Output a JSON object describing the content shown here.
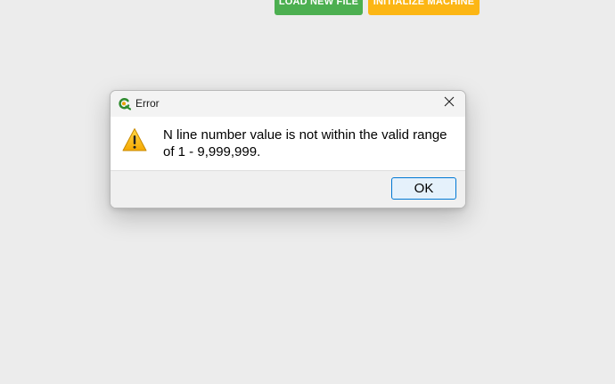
{
  "top_buttons": {
    "load_label": "LOAD NEW FILE",
    "init_label": "INITIALIZE MACHINE",
    "load_color": "#4caf50",
    "init_color": "#fcb614"
  },
  "dialog": {
    "title": "Error",
    "app_icon": "app-logo-icon",
    "close_icon": "close-icon",
    "warning_icon": "warning-triangle-icon",
    "message": "N line number value is not within the valid range of 1 - 9,999,999.",
    "ok_label": "OK"
  }
}
